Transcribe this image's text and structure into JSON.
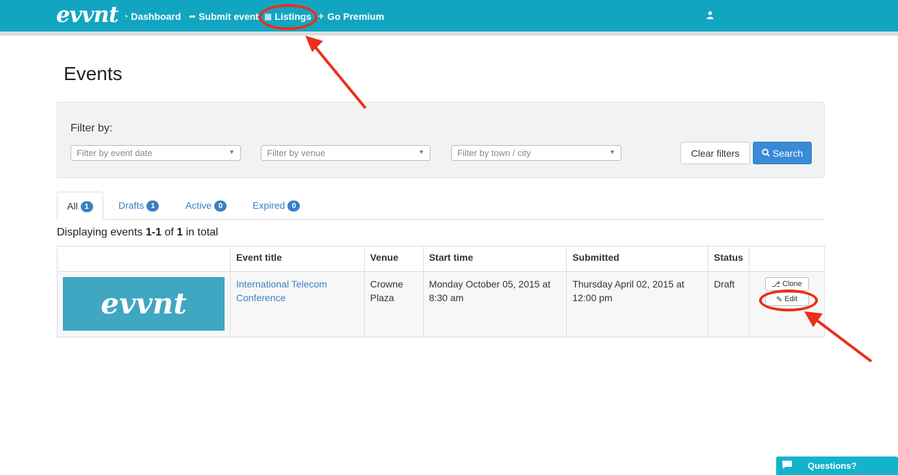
{
  "nav": {
    "logo": "evvnt",
    "items": [
      {
        "icon": "dashboard-icon",
        "glyph": "◔",
        "label": "Dashboard"
      },
      {
        "icon": "share-arrow-icon",
        "glyph": "➦",
        "label": "Submit event"
      },
      {
        "icon": "calendar-icon",
        "glyph": "▦",
        "label": "Listings"
      },
      {
        "icon": "rocket-icon",
        "glyph": "✈",
        "label": "Go Premium"
      }
    ],
    "user_icon": "user-icon"
  },
  "page": {
    "title": "Events"
  },
  "filters": {
    "label": "Filter by:",
    "date_placeholder": "Filter by event date",
    "venue_placeholder": "Filter by venue",
    "city_placeholder": "Filter by town / city",
    "clear_label": "Clear filters",
    "search_label": "Search"
  },
  "tabs": [
    {
      "label": "All",
      "count": "1"
    },
    {
      "label": "Drafts",
      "count": "1"
    },
    {
      "label": "Active",
      "count": "0"
    },
    {
      "label": "Expired",
      "count": "0"
    }
  ],
  "summary": {
    "prefix": "Displaying events",
    "range": "1-1",
    "of": "of",
    "total": "1",
    "suffix": "in total"
  },
  "table": {
    "headers": [
      "",
      "Event title",
      "Venue",
      "Start time",
      "Submitted",
      "Status",
      ""
    ],
    "rows": [
      {
        "thumb_text": "evvnt",
        "title": "International Telecom Conference",
        "venue": "Crowne Plaza",
        "start": "Monday October 05, 2015 at 8:30 am",
        "submitted": "Thursday April 02, 2015 at 12:00 pm",
        "status": "Draft",
        "clone_label": "Clone",
        "edit_label": "Edit"
      }
    ]
  },
  "widget": {
    "label": "Questions?"
  },
  "colors": {
    "navbar": "#12a5c2",
    "link": "#3b7fc4",
    "primary": "#3b8ad8",
    "annotation": "#ea2f1a"
  }
}
